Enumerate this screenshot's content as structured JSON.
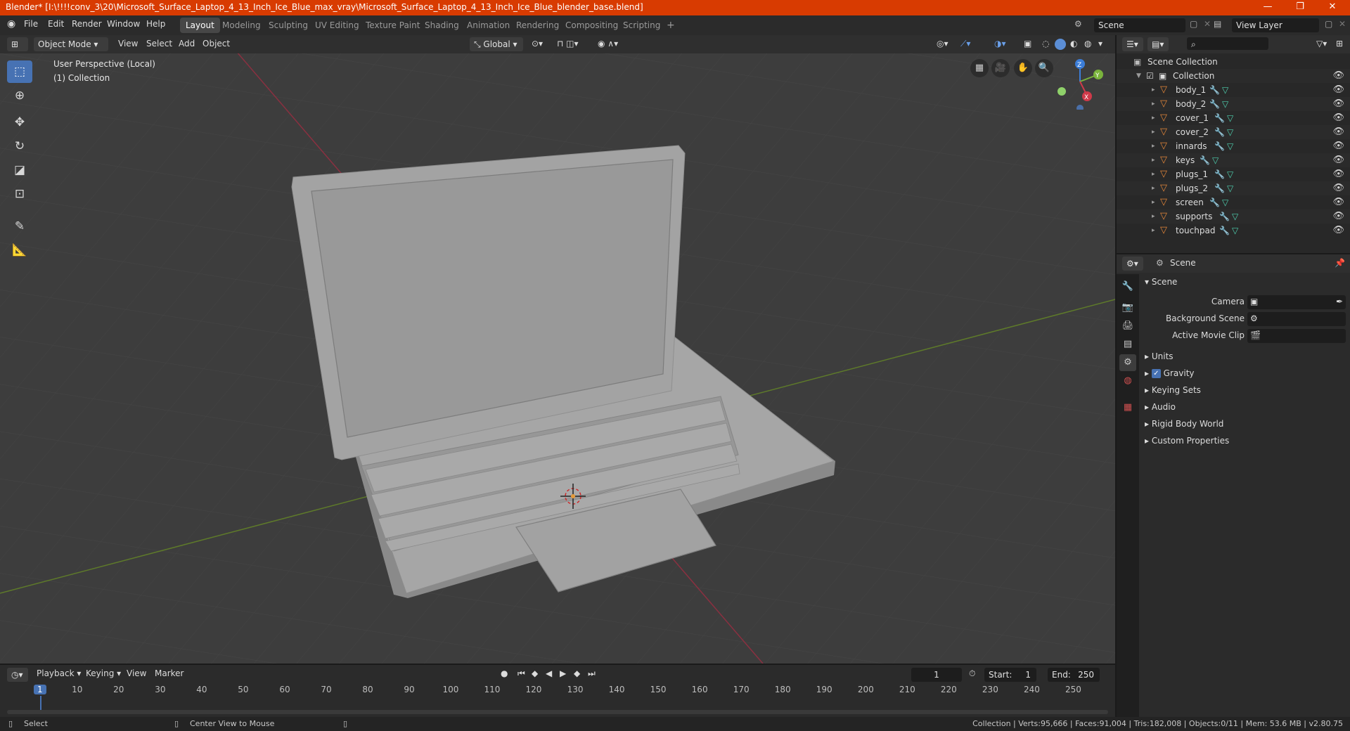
{
  "window": {
    "title": "Blender* [I:\\!!!!conv_3\\20\\Microsoft_Surface_Laptop_4_13_Inch_Ice_Blue_max_vray\\Microsoft_Surface_Laptop_4_13_Inch_Ice_Blue_blender_base.blend]",
    "minimize": "—",
    "maximize": "❐",
    "close": "✕"
  },
  "menu": {
    "items": [
      "File",
      "Edit",
      "Render",
      "Window",
      "Help"
    ],
    "workspaces": [
      "Layout",
      "Modeling",
      "Sculpting",
      "UV Editing",
      "Texture Paint",
      "Shading",
      "Animation",
      "Rendering",
      "Compositing",
      "Scripting"
    ],
    "add_workspace": "+",
    "scene": "Scene",
    "view_layer": "View Layer"
  },
  "viewport_header": {
    "mode": "Object Mode",
    "menus": [
      "View",
      "Select",
      "Add",
      "Object"
    ],
    "orientation": "Global"
  },
  "viewport": {
    "perspective": "User Perspective (Local)",
    "collection": "(1) Collection",
    "gizmo": {
      "z": "Z",
      "y": "Y",
      "x": "X"
    }
  },
  "outliner": {
    "root": "Scene Collection",
    "collection": "Collection",
    "objects": [
      "body_1",
      "body_2",
      "cover_1",
      "cover_2",
      "innards",
      "keys",
      "plugs_1",
      "plugs_2",
      "screen",
      "supports",
      "touchpad"
    ]
  },
  "properties": {
    "context": "Scene",
    "panel": "Scene",
    "camera_label": "Camera",
    "background_scene_label": "Background Scene",
    "movie_clip_label": "Active Movie Clip",
    "sections": [
      "Units",
      "Gravity",
      "Keying Sets",
      "Audio",
      "Rigid Body World",
      "Custom Properties"
    ],
    "gravity_checked": true
  },
  "timeline": {
    "menus": [
      "Playback",
      "Keying",
      "View",
      "Marker"
    ],
    "current_frame": "1",
    "start_label": "Start:",
    "start": "1",
    "end_label": "End:",
    "end": "250",
    "ticks": [
      "1",
      "10",
      "20",
      "30",
      "40",
      "50",
      "60",
      "70",
      "80",
      "90",
      "100",
      "110",
      "120",
      "130",
      "140",
      "150",
      "160",
      "170",
      "180",
      "190",
      "200",
      "210",
      "220",
      "230",
      "240",
      "250"
    ]
  },
  "status": {
    "left1": "Select",
    "left2": "Center View to Mouse",
    "right": "Collection | Verts:95,666 | Faces:91,004 | Tris:182,008 | Objects:0/11 | Mem: 53.6 MB | v2.80.75"
  },
  "colors": {
    "accent": "#4772b3",
    "titlebar": "#d83b01",
    "object_icon": "#e5873a",
    "x_axis": "#c8344a",
    "y_axis": "#7aa43a"
  }
}
